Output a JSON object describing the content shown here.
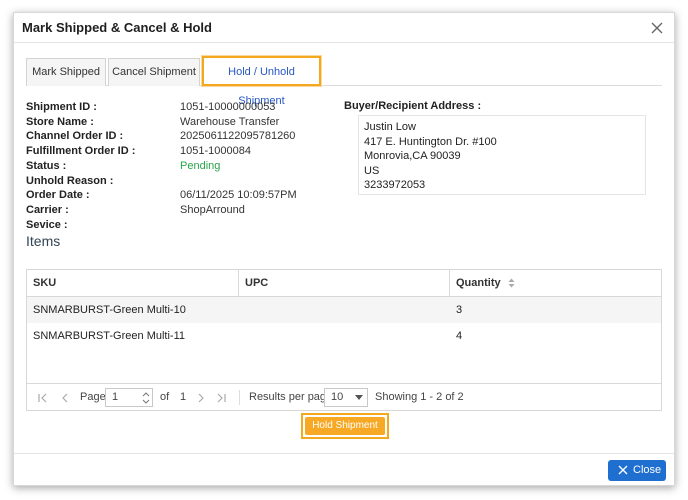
{
  "modal": {
    "title": "Mark Shipped & Cancel & Hold",
    "close_label": "Close"
  },
  "tabs": [
    {
      "label": "Mark Shipped",
      "active": false
    },
    {
      "label": "Cancel Shipment",
      "active": false
    },
    {
      "label": "Hold / Unhold Shipment",
      "active": true
    }
  ],
  "details": {
    "labels": {
      "shipment_id": "Shipment ID :",
      "store_name": "Store Name :",
      "channel_order_id": "Channel Order ID :",
      "fulfillment_order_id": "Fulfillment Order ID :",
      "status": "Status :",
      "unhold_reason": "Unhold Reason :",
      "order_date": "Order Date :",
      "carrier": "Carrier :",
      "service": "Sevice :"
    },
    "values": {
      "shipment_id": "1051-10000000053",
      "store_name": "Warehouse Transfer",
      "channel_order_id": "2025061122095781260",
      "fulfillment_order_id": "1051-1000084",
      "status": "Pending",
      "unhold_reason": "",
      "order_date": "06/11/2025 10:09:57PM",
      "carrier": "ShopArround",
      "service": ""
    },
    "status_color": "#2aa34a"
  },
  "address": {
    "label": "Buyer/Recipient Address :",
    "lines": [
      "Justin Low",
      "417 E. Huntington Dr. #100",
      "Monrovia,CA 90039",
      "US",
      "3233972053"
    ]
  },
  "items": {
    "title": "Items",
    "columns": [
      "SKU",
      "UPC",
      "Quantity"
    ],
    "rows": [
      {
        "sku": "SNMARBURST-Green Multi-10",
        "upc": "",
        "quantity": "3"
      },
      {
        "sku": "SNMARBURST-Green Multi-11",
        "upc": "",
        "quantity": "4"
      }
    ]
  },
  "pager": {
    "page_label": "Page",
    "page_value": "1",
    "of_label": "of",
    "total_pages": "1",
    "rpp_label": "Results per page",
    "rpp_value": "10",
    "showing": "Showing 1 - 2 of 2"
  },
  "actions": {
    "hold_label": "Hold Shipment"
  },
  "colors": {
    "accent": "#f7a925",
    "active_tab_text": "#2757c4",
    "close_button": "#1f6fd1"
  }
}
